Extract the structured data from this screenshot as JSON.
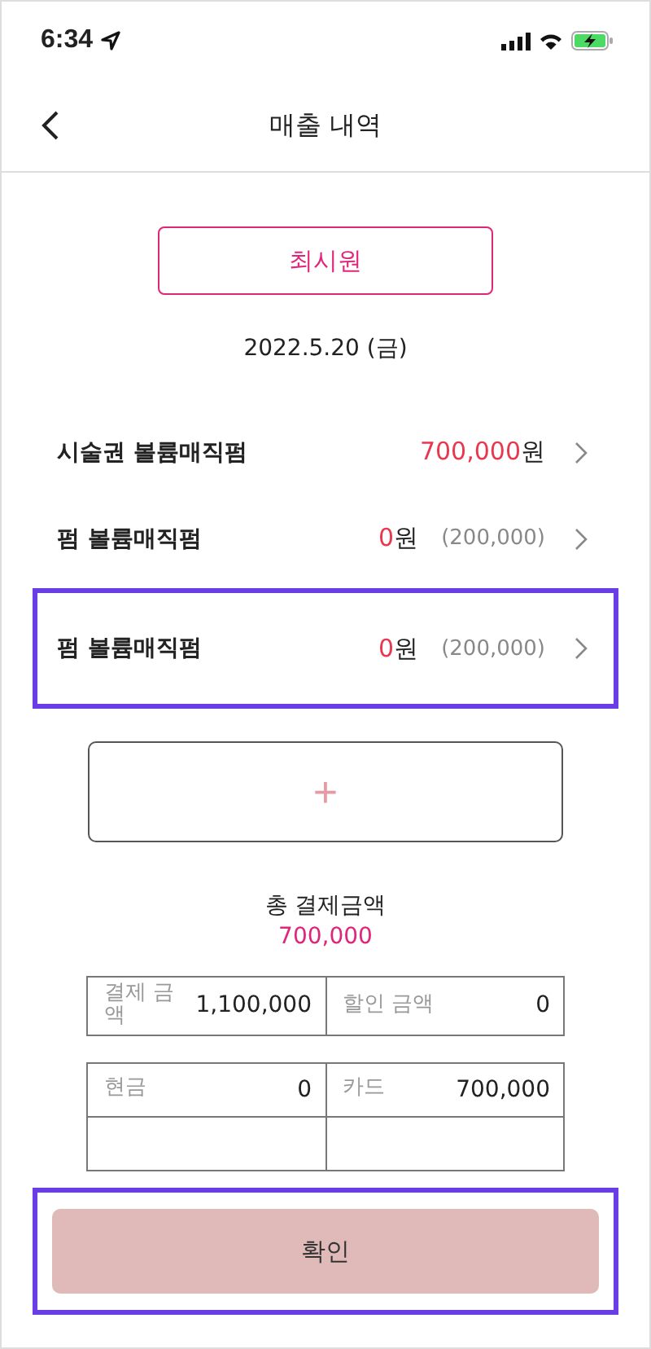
{
  "status_bar": {
    "time": "6:34"
  },
  "header": {
    "title": "매출 내역"
  },
  "customer": {
    "name": "최시원"
  },
  "date": "2022.5.20 (금)",
  "items": [
    {
      "name": "시술권 볼륨매직펌",
      "amount": "700,000",
      "unit": "원",
      "highlighted": false
    },
    {
      "name": "펌 볼륨매직펌",
      "amount": "0",
      "unit": "원",
      "original": "(200,000)",
      "highlighted": false
    },
    {
      "name": "펌 볼륨매직펌",
      "amount": "0",
      "unit": "원",
      "original": "(200,000)",
      "highlighted": true
    }
  ],
  "add_button": {
    "label": "+"
  },
  "total": {
    "label": "총 결제금액",
    "amount": "700,000"
  },
  "summary_tables": [
    {
      "rows": [
        [
          {
            "label": "결제 금액",
            "value": "1,100,000"
          },
          {
            "label": "할인 금액",
            "value": "0"
          }
        ]
      ]
    },
    {
      "rows": [
        [
          {
            "label": "현금",
            "value": "0"
          },
          {
            "label": "카드",
            "value": "700,000"
          }
        ]
      ]
    }
  ],
  "confirm": {
    "label": "확인",
    "highlighted": true
  }
}
